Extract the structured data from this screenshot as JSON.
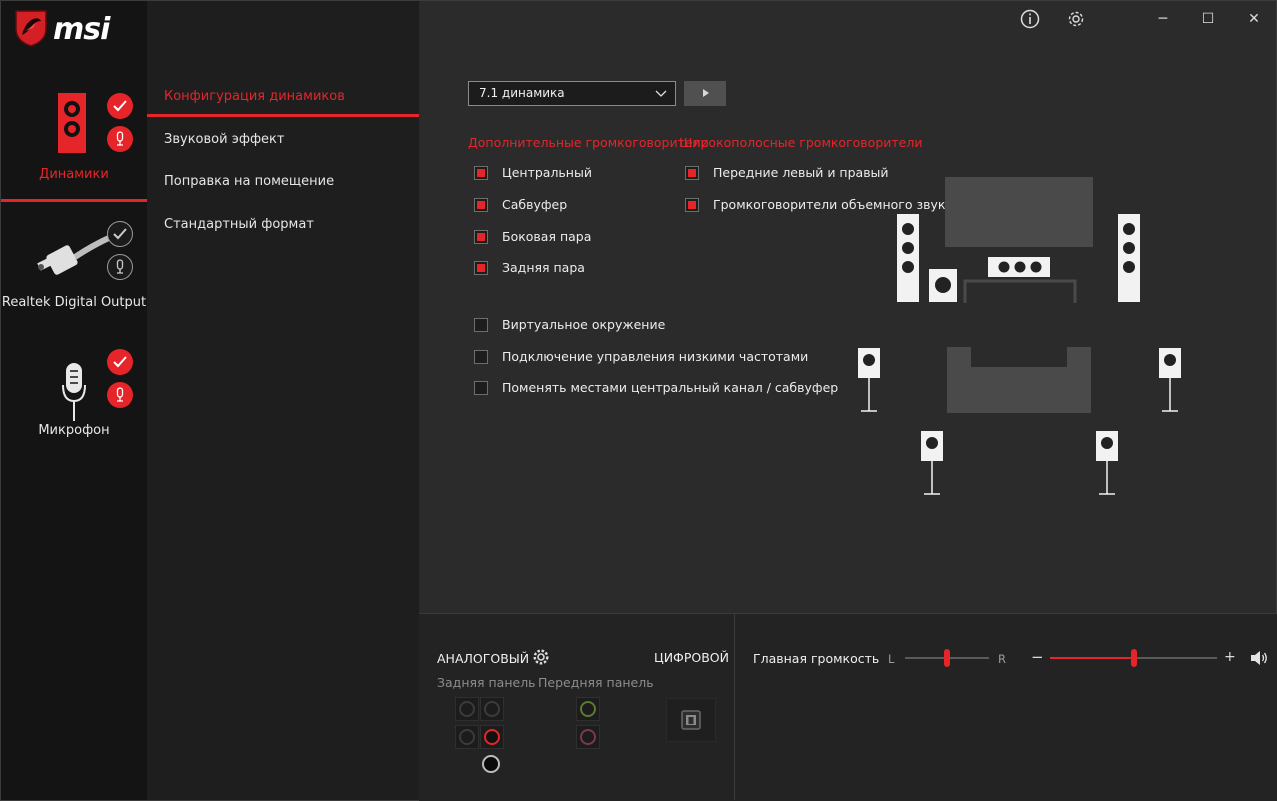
{
  "app": {
    "logo_text": "msi"
  },
  "title_bar": {
    "info_icon": "info-icon",
    "settings_icon": "gear-icon",
    "minimize": "─",
    "maximize": "☐",
    "close": "✕"
  },
  "devices": [
    {
      "label": "Динамики",
      "active": true
    },
    {
      "label": "Realtek Digital Output",
      "active": false
    },
    {
      "label": "Микрофон",
      "active": false
    }
  ],
  "menu": {
    "items": [
      {
        "label": "Конфигурация динамиков",
        "active": true
      },
      {
        "label": "Звуковой эффект"
      },
      {
        "label": "Поправка на помещение"
      },
      {
        "label": "Стандартный формат"
      }
    ]
  },
  "config": {
    "speaker_select": "7.1 динамика",
    "extra_section_title": "Дополнительные громкоговорители",
    "wideband_section_title": "Широкополосные громкоговорители",
    "extra": [
      {
        "label": "Центральный",
        "checked": true
      },
      {
        "label": "Сабвуфер",
        "checked": true
      },
      {
        "label": "Боковая пара",
        "checked": true
      },
      {
        "label": "Задняя пара",
        "checked": true
      }
    ],
    "wideband": [
      {
        "label": "Передние левый и правый",
        "checked": true
      },
      {
        "label": "Громкоговорители объемного звука",
        "checked": true
      }
    ],
    "options": [
      {
        "label": "Виртуальное окружение",
        "checked": false
      },
      {
        "label": "Подключение управления низкими частотами",
        "checked": false
      },
      {
        "label": "Поменять местами центральный канал / сабвуфер",
        "checked": false
      }
    ]
  },
  "bottom": {
    "analog": "АНАЛОГОВЫЙ",
    "digital": "ЦИФРОВОЙ",
    "rear_panel": "Задняя панель",
    "front_panel": "Передняя панель",
    "master_volume": "Главная громкость",
    "balance_left": "L",
    "balance_right": "R",
    "balance_value": 0.5,
    "volume_minus": "−",
    "volume_plus": "+",
    "volume_value": 0.5
  },
  "colors": {
    "accent": "#e5252a",
    "sidebar": "#141414",
    "menu": "#1e1e1e",
    "main": "#2b2b2b"
  }
}
